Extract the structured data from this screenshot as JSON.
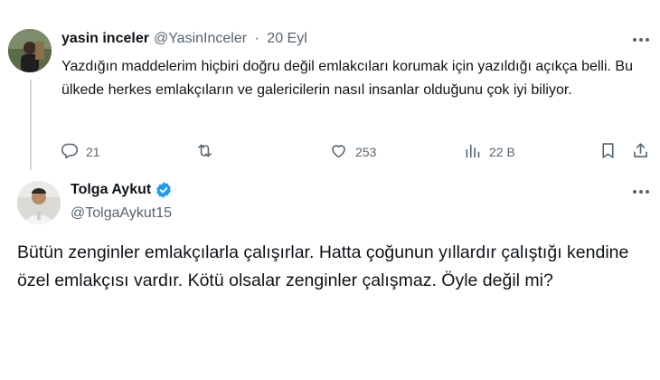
{
  "reply_tweet": {
    "author_name": "yasin inceler",
    "handle": "@YasinInceler",
    "separator": "·",
    "date": "20 Eyl",
    "text": "Yazdığın maddelerim hiçbiri doğru değil emlakcıları korumak için yazıldığı açıkça belli. Bu ülkede herkes emlakçıların ve galericilerin nasıl insanlar olduğunu çok iyi biliyor.",
    "actions": {
      "replies": "21",
      "retweets": "",
      "likes": "253",
      "views": "22 B"
    },
    "icons": [
      "more-icon",
      "reply-icon",
      "retweet-icon",
      "like-icon",
      "views-icon",
      "bookmark-icon",
      "share-icon"
    ]
  },
  "main_tweet": {
    "author_name": "Tolga Aykut",
    "handle": "@TolgaAykut15",
    "verified": true,
    "text": "Bütün zenginler emlakçılarla çalışırlar. Hatta çoğunun yıllardır çalıştığı kendine özel emlakçısı vardır. Kötü olsalar zenginler çalışmaz. Öyle değil mi?"
  },
  "colors": {
    "text_primary": "#0f1419",
    "text_secondary": "#536471",
    "verified_blue": "#1d9bf0",
    "thread_line": "#cfd9de"
  }
}
